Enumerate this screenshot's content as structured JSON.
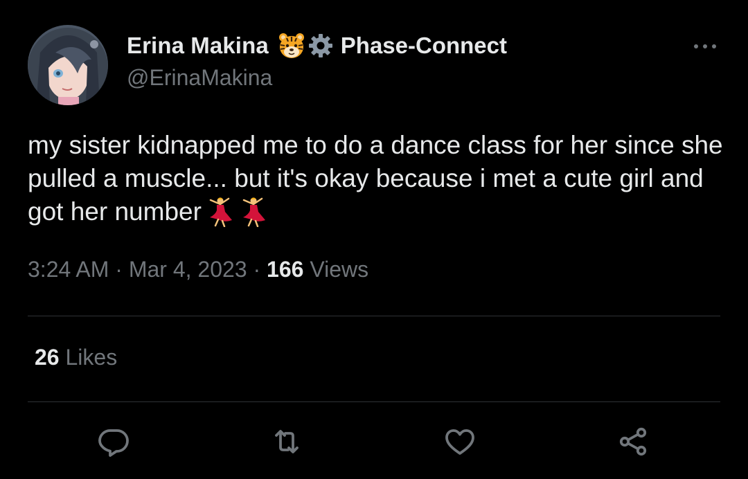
{
  "author": {
    "display_name": "Erina Makina",
    "badges": [
      "tiger-icon",
      "gear-icon"
    ],
    "affiliation": "Phase-Connect",
    "handle": "@ErinaMakina"
  },
  "tweet": {
    "text": "my sister kidnapped me to do a dance class for her since she pulled a muscle... but it's okay because i met a cute girl and got her number",
    "emojis": [
      "dancer-icon",
      "dancer-icon"
    ],
    "time": "3:24 AM",
    "separator": "·",
    "date": "Mar 4, 2023",
    "views_count": "166",
    "views_label": "Views"
  },
  "engagement": {
    "likes_count": "26",
    "likes_label": "Likes"
  },
  "actions": [
    "reply-icon",
    "retweet-icon",
    "like-icon",
    "share-icon"
  ],
  "colors": {
    "background": "#000000",
    "text_primary": "#e7e9ea",
    "text_secondary": "#71767b",
    "divider": "#2f3336"
  }
}
